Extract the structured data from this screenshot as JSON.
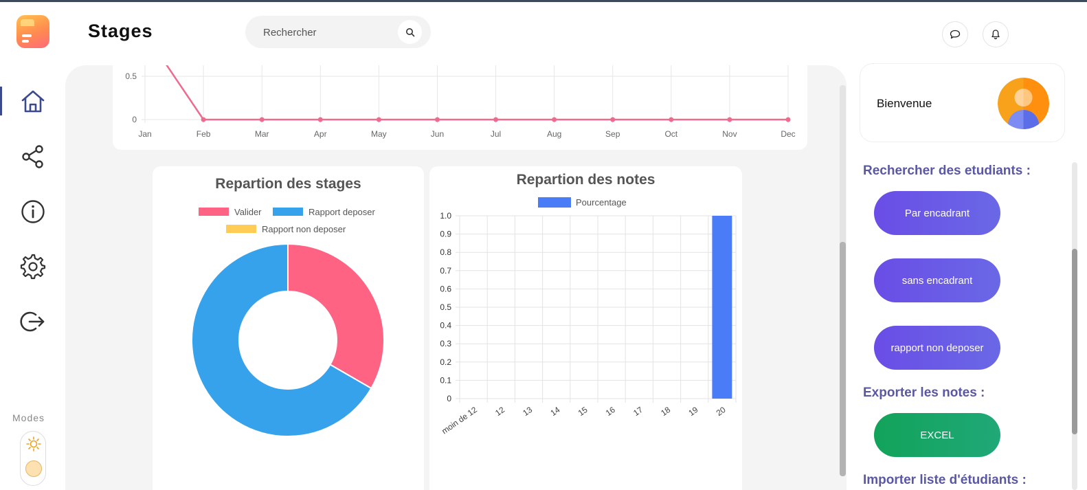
{
  "header": {
    "title": "Stages",
    "search_placeholder": "Rechercher"
  },
  "sidebar": {
    "items": [
      {
        "name": "home",
        "icon": "home-icon",
        "active": true
      },
      {
        "name": "share",
        "icon": "share-icon"
      },
      {
        "name": "info",
        "icon": "info-icon"
      },
      {
        "name": "settings",
        "icon": "gear-icon"
      },
      {
        "name": "logout",
        "icon": "logout-icon"
      }
    ],
    "modes_label": "Modes"
  },
  "colors": {
    "accent": "#5a57a3",
    "pink": "#ff6384",
    "blue": "#36a2eb",
    "yellow": "#ffcd56",
    "bar_blue": "#4a7cf7"
  },
  "chart_data": [
    {
      "type": "line",
      "x": [
        "Jan",
        "Feb",
        "Mar",
        "Apr",
        "May",
        "Jun",
        "Jul",
        "Aug",
        "Sep",
        "Oct",
        "Nov",
        "Dec"
      ],
      "series": [
        {
          "values": [
            1,
            0,
            0,
            0,
            0,
            0,
            0,
            0,
            0,
            0,
            0,
            0
          ]
        }
      ],
      "y_ticks_visible": [
        "0.5",
        "0"
      ],
      "grid": true
    },
    {
      "type": "pie",
      "title": "Repartion des stages",
      "labels": [
        "Valider",
        "Rapport deposer",
        "Rapport non deposer"
      ],
      "values": [
        1,
        2,
        0
      ],
      "legend": "top"
    },
    {
      "type": "bar",
      "title": "Repartion des notes",
      "categories": [
        "moin de 12",
        "12",
        "13",
        "14",
        "15",
        "16",
        "17",
        "18",
        "19",
        "20"
      ],
      "series": [
        {
          "name": "Pourcentage",
          "values": [
            0,
            0,
            0,
            0,
            0,
            0,
            0,
            0,
            0,
            1.0
          ]
        }
      ],
      "ylim": [
        0,
        1.0
      ],
      "y_ticks": [
        "0",
        "0.1",
        "0.2",
        "0.3",
        "0.4",
        "0.5",
        "0.6",
        "0.7",
        "0.8",
        "0.9",
        "1.0"
      ],
      "legend": "top",
      "grid": true
    }
  ],
  "right_panel": {
    "welcome": "Bienvenue",
    "search_title": "Rechercher des etudiants :",
    "buttons": [
      "Par encadrant",
      "sans encadrant",
      "rapport non deposer"
    ],
    "export_title": "Exporter les notes :",
    "export_button": "EXCEL",
    "import_title": "Importer liste d'étudiants :"
  }
}
